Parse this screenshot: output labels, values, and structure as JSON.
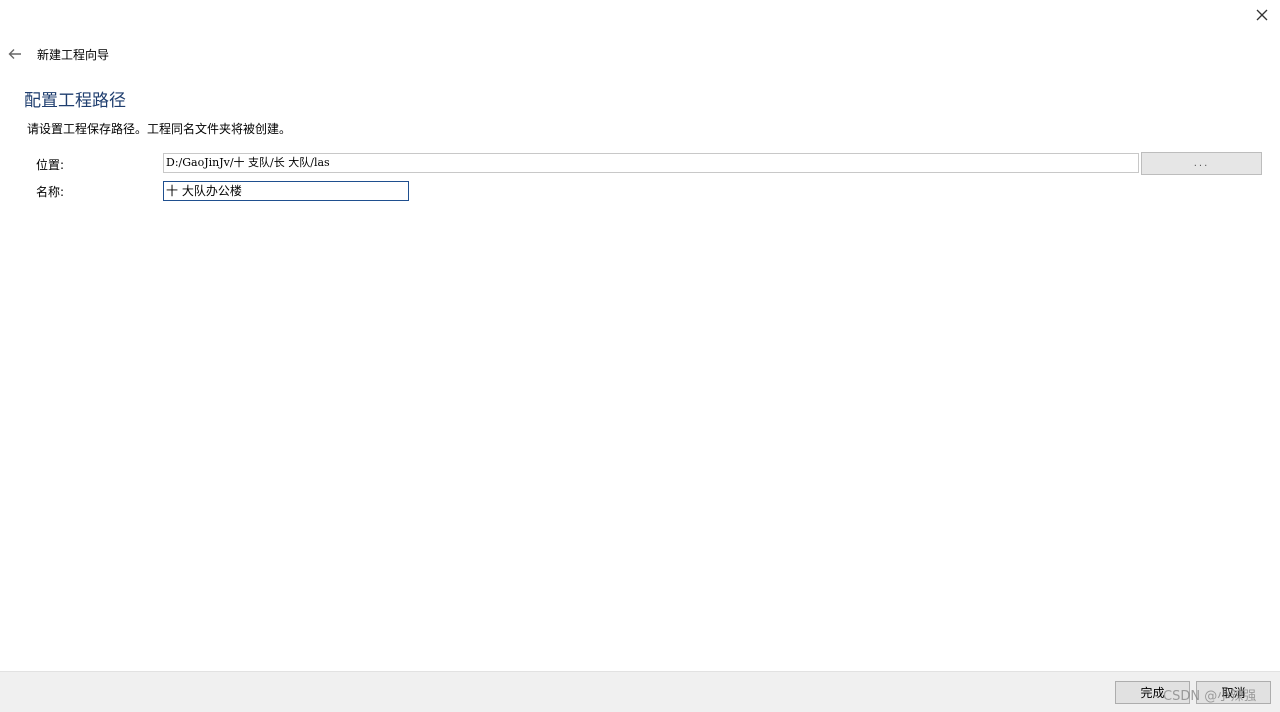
{
  "window": {
    "close_icon": "close-icon"
  },
  "header": {
    "back_icon": "arrow-left-icon",
    "title": "新建工程向导"
  },
  "page": {
    "section_title": "配置工程路径",
    "description": "请设置工程保存路径。工程同名文件夹将被创建。"
  },
  "form": {
    "location_label": "位置:",
    "location_value": "D:/GaoJinJv/十  支队/长   大队/las",
    "browse_label": "...",
    "name_label": "名称:",
    "name_value": "十     大队办公楼"
  },
  "footer": {
    "finish_label": "完成",
    "cancel_label": "取消"
  },
  "watermark": "CSDN @小辣强",
  "colors": {
    "section_title": "#1f3e6f",
    "footer_bg": "#f0f0f0",
    "active_input_border": "#1f4f8f"
  }
}
